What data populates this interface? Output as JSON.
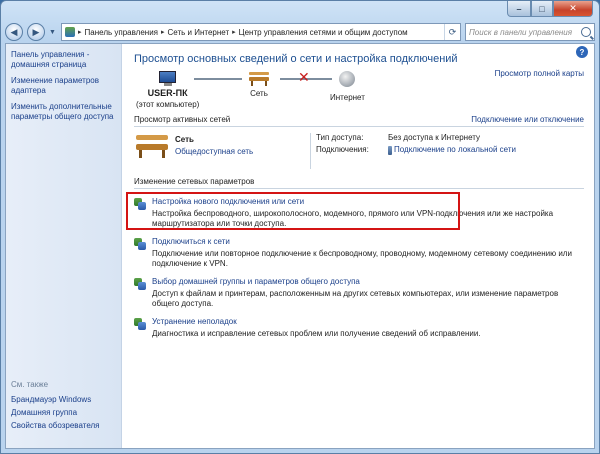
{
  "window": {
    "minimize": "–",
    "maximize": "□",
    "close": "✕"
  },
  "address": {
    "crumbs": [
      "Панель управления",
      "Сеть и Интернет",
      "Центр управления сетями и общим доступом"
    ],
    "search_placeholder": "Поиск в панели управления"
  },
  "sidebar": {
    "items": [
      "Панель управления - домашняя страница",
      "Изменение параметров адаптера",
      "Изменить дополнительные параметры общего доступа"
    ],
    "see_also_title": "См. также",
    "see_also": [
      "Брандмауэр Windows",
      "Домашняя группа",
      "Свойства обозревателя"
    ]
  },
  "main": {
    "help": "?",
    "title": "Просмотр основных сведений о сети и настройка подключений",
    "view_full_map": "Просмотр полной карты",
    "map": {
      "computer": "USER-ПК",
      "computer_sub": "(этот компьютер)",
      "network": "Сеть",
      "internet": "Интернет"
    },
    "active_header": "Просмотр активных сетей",
    "connect_disconnect": "Подключение или отключение",
    "active_network": {
      "name": "Сеть",
      "type": "Общедоступная сеть",
      "access_label": "Тип доступа:",
      "access_value": "Без доступа к Интернету",
      "connections_label": "Подключения:",
      "connections_value": "Подключение по локальной сети"
    },
    "change_header": "Изменение сетевых параметров",
    "tasks": [
      {
        "title": "Настройка нового подключения или сети",
        "desc": "Настройка беспроводного, широкополосного, модемного, прямого или VPN-подключения или же настройка маршрутизатора или точки доступа."
      },
      {
        "title": "Подключиться к сети",
        "desc": "Подключение или повторное подключение к беспроводному, проводному, модемному сетевому соединению или подключение к VPN."
      },
      {
        "title": "Выбор домашней группы и параметров общего доступа",
        "desc": "Доступ к файлам и принтерам, расположенным на других сетевых компьютерах, или изменение параметров общего доступа."
      },
      {
        "title": "Устранение неполадок",
        "desc": "Диагностика и исправление сетевых проблем или получение сведений об исправлении."
      }
    ]
  }
}
